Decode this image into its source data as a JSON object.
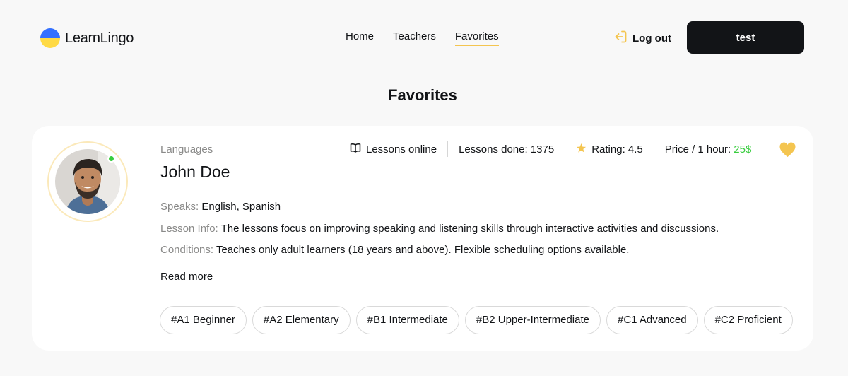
{
  "header": {
    "logo_text": "LearnLingo",
    "nav": [
      {
        "label": "Home",
        "active": false
      },
      {
        "label": "Teachers",
        "active": false
      },
      {
        "label": "Favorites",
        "active": true
      }
    ],
    "logout_label": "Log out",
    "user_button_label": "test"
  },
  "page": {
    "title": "Favorites"
  },
  "teacher": {
    "languages_label": "Languages",
    "name": "John Doe",
    "stats": {
      "lessons_online": "Lessons online",
      "lessons_done": "Lessons done: 1375",
      "rating": "Rating: 4.5",
      "price_label": "Price / 1 hour: ",
      "price_value": "25$"
    },
    "speaks_label": "Speaks: ",
    "speaks_value": "English, Spanish",
    "lesson_info_label": "Lesson Info: ",
    "lesson_info_value": "The lessons focus on improving speaking and listening skills through interactive activities and discussions.",
    "conditions_label": "Conditions: ",
    "conditions_value": "Teaches only adult learners (18 years and above). Flexible scheduling options available.",
    "read_more": "Read more",
    "levels": [
      "#A1 Beginner",
      "#A2 Elementary",
      "#B1 Intermediate",
      "#B2 Upper-Intermediate",
      "#C1 Advanced",
      "#C2 Proficient"
    ],
    "is_favorite": true,
    "online": true
  },
  "colors": {
    "accent": "#f4c550",
    "dark": "#121417",
    "price": "#38cd3e",
    "online": "#38cd3e",
    "muted": "#8a8a89"
  }
}
